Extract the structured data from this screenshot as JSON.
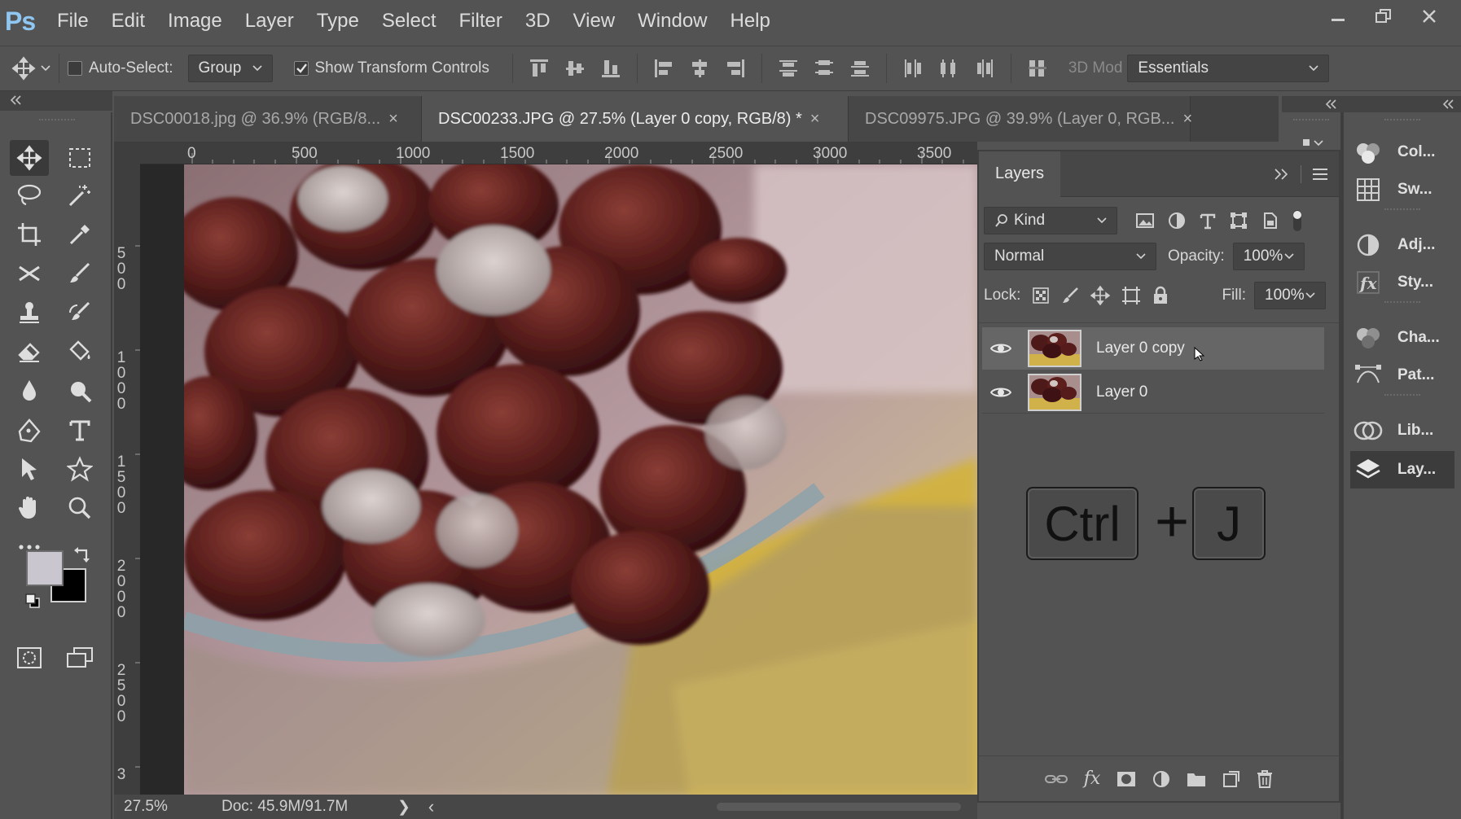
{
  "app": {
    "logo": "Ps"
  },
  "menu": [
    "File",
    "Edit",
    "Image",
    "Layer",
    "Type",
    "Select",
    "Filter",
    "3D",
    "View",
    "Window",
    "Help"
  ],
  "options": {
    "auto_select_label": "Auto-Select:",
    "auto_select_checked": false,
    "group_value": "Group",
    "show_transform_label": "Show Transform Controls",
    "show_transform_checked": true,
    "mode_3d_label": "3D Mod",
    "workspace_value": "Essentials"
  },
  "tabs": [
    {
      "label": "DSC00018.jpg @ 36.9% (RGB/8...",
      "active": false
    },
    {
      "label": "DSC00233.JPG @ 27.5% (Layer 0 copy, RGB/8) *",
      "active": true
    },
    {
      "label": "DSC09975.JPG @ 39.9% (Layer 0, RGB...",
      "active": false
    }
  ],
  "ruler": {
    "top": [
      "0",
      "500",
      "1000",
      "1500",
      "2000",
      "2500",
      "3000",
      "3500"
    ],
    "left": [
      "500",
      "1000",
      "1500",
      "2000",
      "2500",
      "3"
    ]
  },
  "status": {
    "zoom": "27.5%",
    "doc": "Doc: 45.9M/91.7M",
    "arrow": "❯",
    "scroll_left": "‹"
  },
  "layers_panel": {
    "title": "Layers",
    "filter_kind": "Kind",
    "blend_mode": "Normal",
    "opacity_label": "Opacity:",
    "opacity_value": "100%",
    "lock_label": "Lock:",
    "fill_label": "Fill:",
    "fill_value": "100%",
    "layers": [
      {
        "name": "Layer 0 copy",
        "selected": true,
        "visible": true
      },
      {
        "name": "Layer 0",
        "selected": false,
        "visible": true
      }
    ],
    "shortcut": {
      "key1": "Ctrl",
      "plus": "+",
      "key2": "J"
    }
  },
  "dock": [
    {
      "label": "Col...",
      "icon": "color-icon"
    },
    {
      "label": "Sw...",
      "icon": "swatches-icon"
    },
    {
      "label": "Adj...",
      "icon": "adjustments-icon"
    },
    {
      "label": "Sty...",
      "icon": "styles-icon"
    },
    {
      "label": "Cha...",
      "icon": "channels-icon"
    },
    {
      "label": "Pat...",
      "icon": "paths-icon"
    },
    {
      "label": "Lib...",
      "icon": "libraries-icon"
    },
    {
      "label": "Lay...",
      "icon": "layers-icon"
    }
  ],
  "colors": {
    "foreground": "#c9c6cf",
    "background": "#000000",
    "logo": "#8fc6f2"
  }
}
